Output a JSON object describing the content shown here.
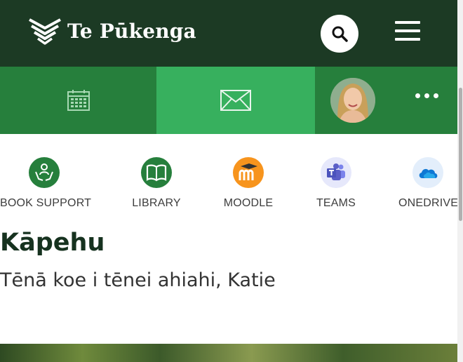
{
  "brand": {
    "name": "Te Pūkenga"
  },
  "header": {
    "search_icon": "search-icon",
    "menu_icon": "hamburger-menu-icon"
  },
  "nav": {
    "items": [
      {
        "icon": "calendar-icon",
        "active": false
      },
      {
        "icon": "mail-icon",
        "active": true
      },
      {
        "icon": "user-avatar"
      },
      {
        "icon": "more-options-icon"
      }
    ]
  },
  "quick_links": [
    {
      "label": "BOOK SUPPORT",
      "icon": "support-hands-icon",
      "color": "#267f3c"
    },
    {
      "label": "LIBRARY",
      "icon": "book-icon",
      "color": "#267f3c"
    },
    {
      "label": "MOODLE",
      "icon": "moodle-icon",
      "color": "#f7941d"
    },
    {
      "label": "TEAMS",
      "icon": "teams-icon",
      "color": "#5b5fc7"
    },
    {
      "label": "ONEDRIVE",
      "icon": "onedrive-icon",
      "color": "#0f78d4"
    }
  ],
  "main": {
    "title": "Kāpehu",
    "greeting": "Tēnā koe i tēnei ahiahi, Katie"
  },
  "colors": {
    "header_bg": "#1c3a24",
    "nav_bg": "#267f3c",
    "nav_active_bg": "#37b05e"
  }
}
